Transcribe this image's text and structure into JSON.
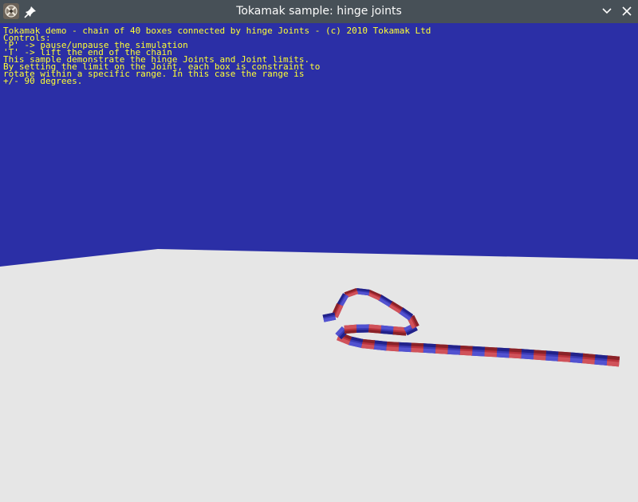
{
  "window": {
    "title": "Tokamak sample: hinge joints",
    "app_icon": "tokamak-app-icon",
    "pin_icon": "pin-icon",
    "minimize_icon": "chevron-down-icon",
    "close_icon": "close-icon"
  },
  "overlay": {
    "lines": [
      "Tokamak demo - chain of 40 boxes connected by hinge Joints - (c) 2010 Tokamak Ltd",
      "Controls:",
      "'P' -> pause/unpause the simulation",
      "'T' -> lift the end of the chain",
      "This sample demonstrate the hinge Joints and Joint limits.",
      "By setting the limit on the Joint, each box is constraint to",
      "rotate within a specific range. In this case the range is",
      "+/- 90 degrees."
    ]
  },
  "scene": {
    "sky_color": "#2b2fa6",
    "floor_color": "#e6e6e6",
    "chain": {
      "box_count": 40,
      "colors": [
        "#b8323c",
        "#3a3ab4"
      ]
    }
  }
}
